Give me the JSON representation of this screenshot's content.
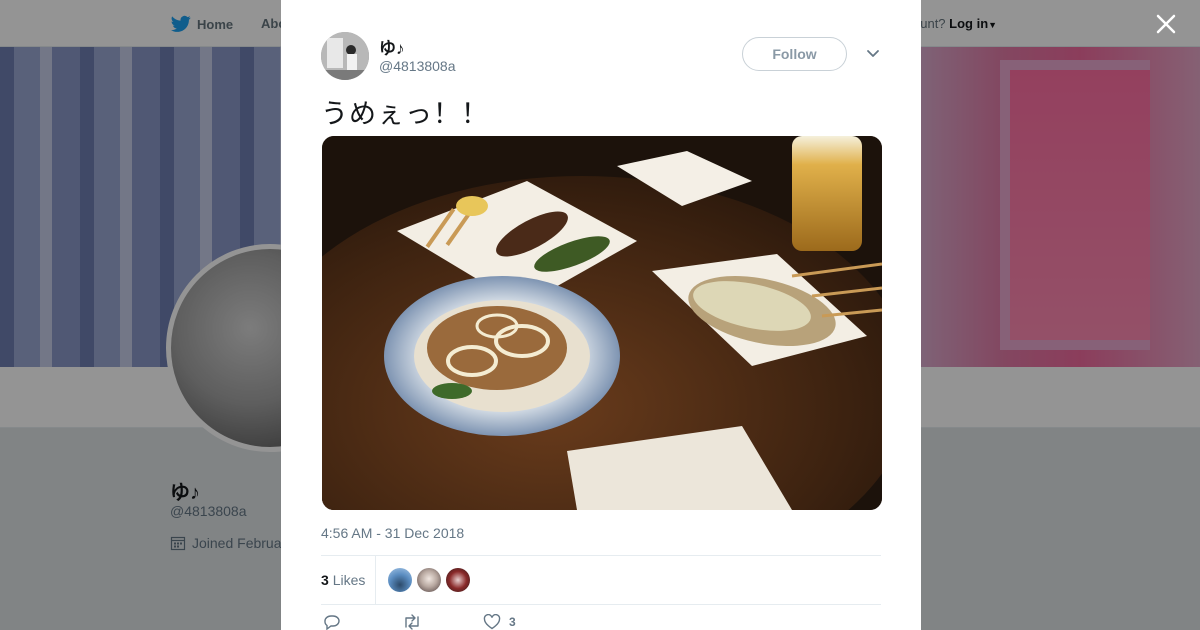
{
  "background": {
    "nav": {
      "home_label": "Home",
      "about_label": "Abo",
      "account_prompt": "ccount?",
      "login_label": "Log in"
    },
    "profile": {
      "name": "ゆ♪",
      "handle": "@4813808a",
      "joined": "Joined Februa"
    }
  },
  "tweet": {
    "author_name": "ゆ♪",
    "author_handle": "@4813808a",
    "follow_label": "Follow",
    "text": "うめぇっ！！",
    "timestamp": "4:56 AM - 31 Dec 2018",
    "likes_count": "3",
    "likes_label": "Likes",
    "action_like_count": "3"
  },
  "colors": {
    "brand_blue": "#1da1f2",
    "text_primary": "#14171a",
    "text_secondary": "#657786"
  },
  "icons": {
    "home": "twitter-bird-icon",
    "close": "close-icon",
    "more": "chevron-down-icon",
    "reply": "reply-icon",
    "retweet": "retweet-icon",
    "like": "heart-icon",
    "calendar": "calendar-icon"
  }
}
